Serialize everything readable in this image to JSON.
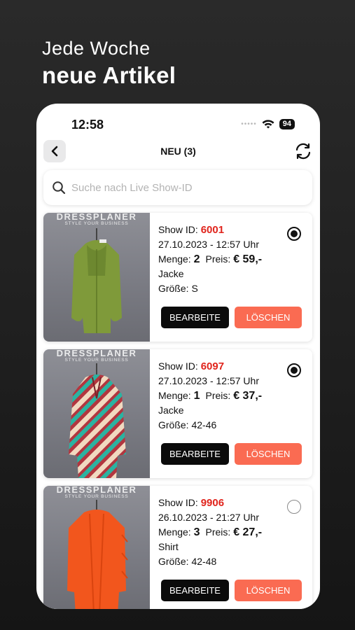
{
  "headline": {
    "line1": "Jede Woche",
    "line2": "neue Artikel"
  },
  "status_bar": {
    "time": "12:58",
    "signal_dots": "•••••",
    "battery": "94"
  },
  "nav": {
    "title": "NEU (3)",
    "back_icon": "chevron-left-icon",
    "refresh_icon": "refresh-icon"
  },
  "search": {
    "placeholder": "Suche nach Live Show-ID",
    "value": ""
  },
  "watermark": {
    "brand": "DRESSPLANER",
    "tagline": "STYLE YOUR BUSINESS"
  },
  "labels": {
    "show_id": "Show ID:",
    "menge": "Menge:",
    "preis": "Preis:",
    "groesse": "Größe:",
    "edit": "BEARBEITE",
    "delete": "LÖSCHEN"
  },
  "items": [
    {
      "show_id": "6001",
      "datetime": "27.10.2023 - 12:57 Uhr",
      "menge": "2",
      "preis": "€ 59,-",
      "type": "Jacke",
      "size": "S",
      "selected": true,
      "garment_color": "#7f9a3a"
    },
    {
      "show_id": "6097",
      "datetime": "27.10.2023 - 12:57 Uhr",
      "menge": "1",
      "preis": "€ 37,-",
      "type": "Jacke",
      "size": "42-46",
      "selected": true,
      "garment_color": "#b2363f"
    },
    {
      "show_id": "9906",
      "datetime": "26.10.2023 - 21:27 Uhr",
      "menge": "3",
      "preis": "€ 27,-",
      "type": "Shirt",
      "size": "42-48",
      "selected": false,
      "garment_color": "#f2561d"
    }
  ],
  "colors": {
    "accent_red": "#e0241c",
    "delete_button": "#fa6b52",
    "edit_button": "#0b0b0b"
  }
}
